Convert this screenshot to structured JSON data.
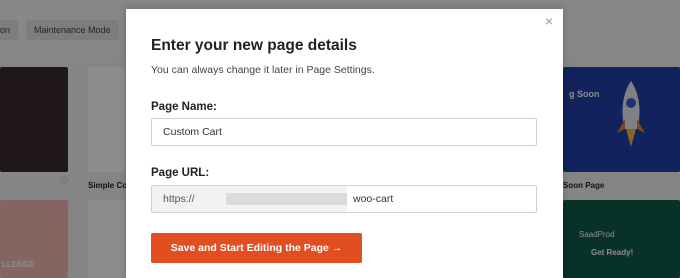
{
  "background": {
    "tabs": [
      "on",
      "Maintenance Mode"
    ],
    "cards": [
      {
        "label": "Simple Co"
      },
      {
        "label": "Soon Page"
      },
      {
        "label": "LLENGE"
      },
      {
        "label": "g Soon"
      },
      {
        "label": "SaadProd"
      },
      {
        "label": "Get Ready!"
      }
    ]
  },
  "modal": {
    "close_icon": "×",
    "title": "Enter your new page details",
    "subtitle": "You can always change it later in Page Settings.",
    "page_name_label": "Page Name:",
    "page_name_value": "Custom Cart",
    "page_url_label": "Page URL:",
    "url_prefix": "https://",
    "url_slash": "/",
    "url_slug": "woo-cart",
    "submit_label": "Save and Start Editing the Page →",
    "accent_color": "#e04e22"
  }
}
